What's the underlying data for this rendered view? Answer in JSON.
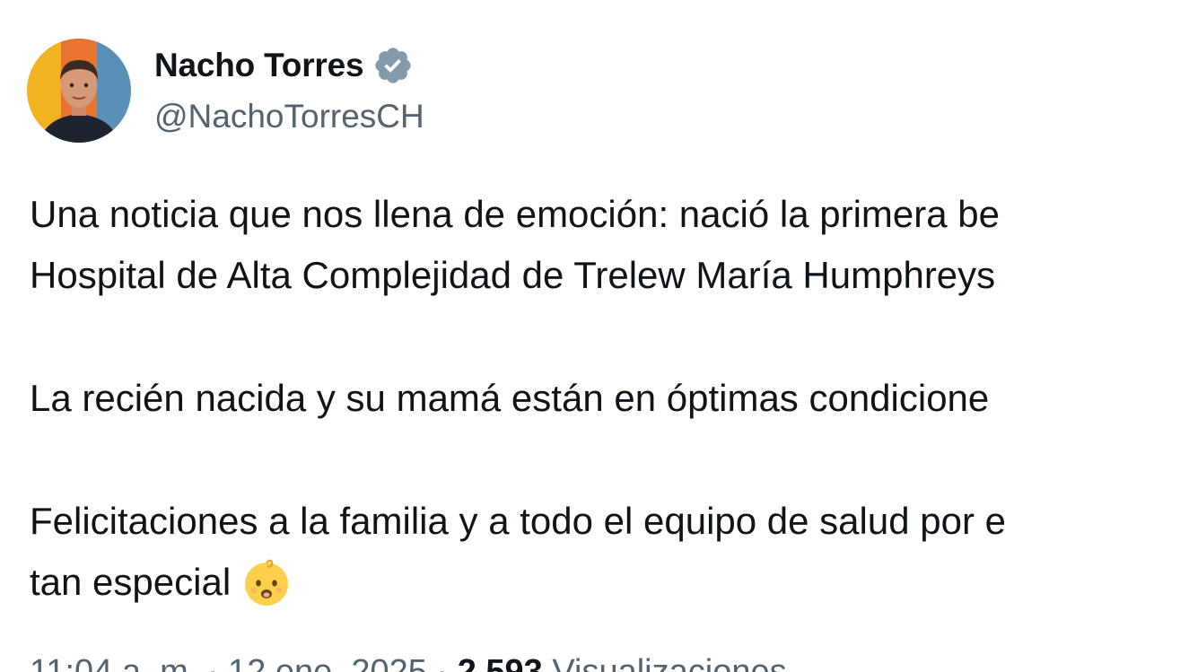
{
  "author": {
    "name": "Nacho Torres",
    "handle": "@NachoTorresCH",
    "verified_icon": "verified-badge-icon",
    "badge_color": "#829aab"
  },
  "post": {
    "lines": [
      "Una noticia que nos llena de emoción: nació la primera be",
      "Hospital de Alta Complejidad de Trelew María Humphreys",
      "La recién nacida y su mamá están en óptimas condicione",
      "Felicitaciones a la familia y a todo el equipo de salud por e",
      "tan especial"
    ],
    "emoji": "baby-emoji-icon"
  },
  "meta": {
    "timestamp": "11:04 a. m. · 12 ene. 2025 ·",
    "views_count": "2.593",
    "views_label": "Visualizaciones"
  },
  "colors": {
    "text": "#0f1419",
    "secondary": "#536471",
    "background": "#ffffff"
  }
}
